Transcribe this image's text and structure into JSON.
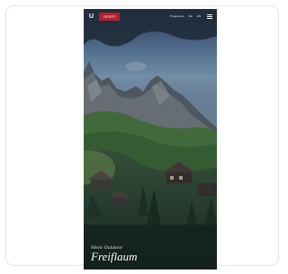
{
  "hero": {
    "logo_text": "U",
    "cta_label": "OFERT",
    "nav": [
      "Programme",
      "Ski",
      "EN"
    ],
    "kicker": "Mein Outdoor",
    "title": "Freiflaum"
  }
}
